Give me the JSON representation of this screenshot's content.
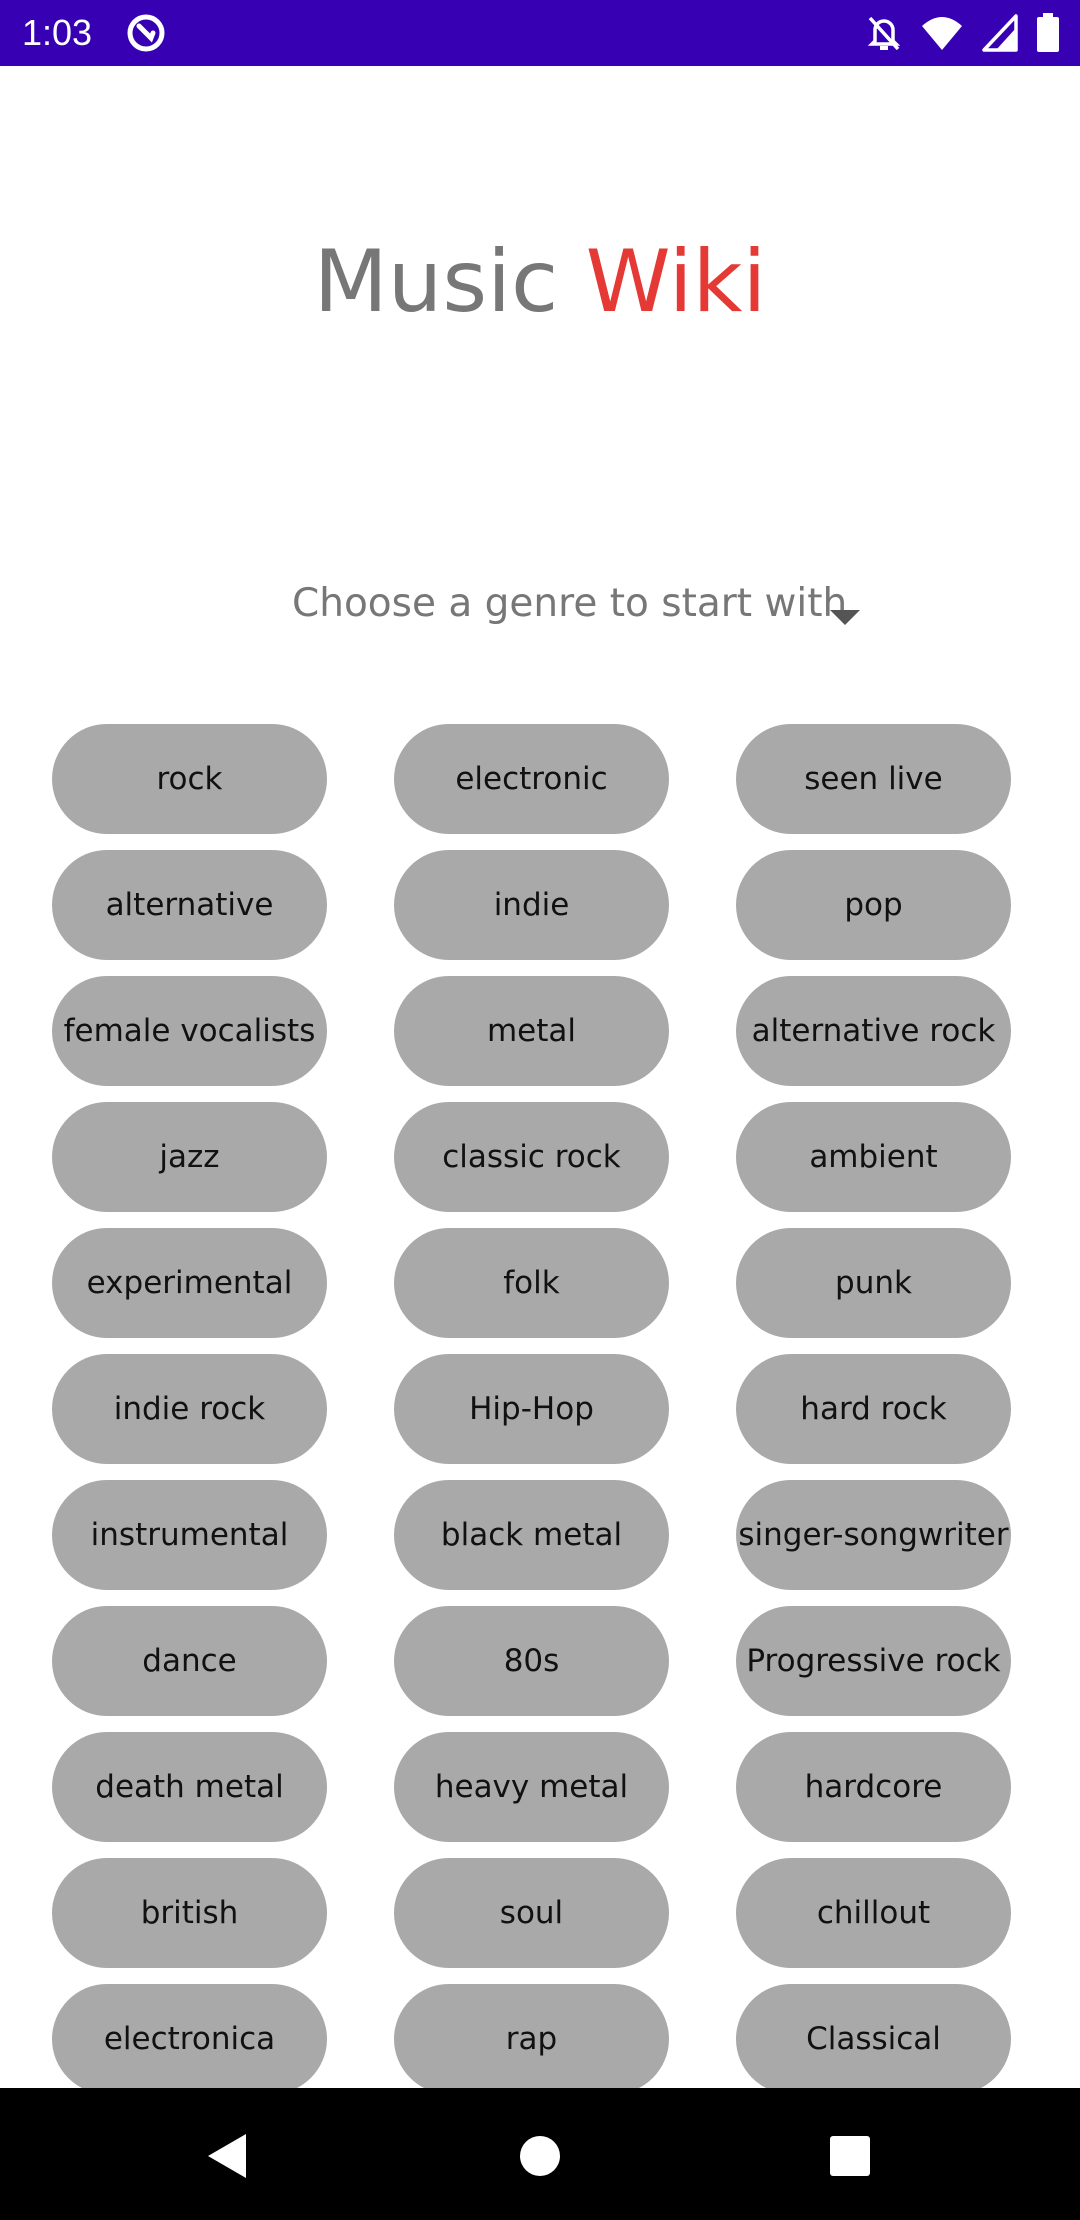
{
  "status_bar": {
    "time": "1:03",
    "icons": [
      "app-notification-icon",
      "do-not-disturb-icon",
      "wifi-icon",
      "cellular-signal-icon",
      "battery-icon"
    ]
  },
  "title": {
    "part1": "Music ",
    "part2": "Wiki",
    "part1_color": "#777777",
    "part2_color": "#e53935"
  },
  "spinner": {
    "text": "Choose a genre to start with",
    "icon": "caret-down-icon"
  },
  "genres": [
    "rock",
    "electronic",
    "seen live",
    "alternative",
    "indie",
    "pop",
    "female vocalists",
    "metal",
    "alternative rock",
    "jazz",
    "classic rock",
    "ambient",
    "experimental",
    "folk",
    "punk",
    "indie rock",
    "Hip-Hop",
    "hard rock",
    "instrumental",
    "black metal",
    "singer-songwriter",
    "dance",
    "80s",
    "Progressive rock",
    "death metal",
    "heavy metal",
    "hardcore",
    "british",
    "soul",
    "chillout",
    "electronica",
    "rap",
    "Classical"
  ],
  "colors": {
    "status_bar": "#3700b3",
    "chip_background": "#a9a9a9",
    "nav_bar": "#000000"
  },
  "nav_bar": {
    "buttons": [
      "back-icon",
      "home-icon",
      "recents-icon"
    ]
  }
}
